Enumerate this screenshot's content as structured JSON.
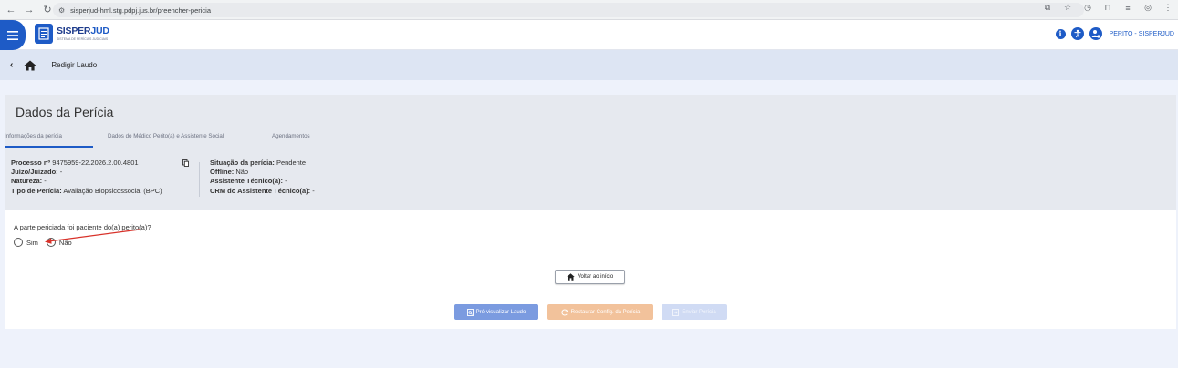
{
  "browser": {
    "url": "sisperjud-hml.stg.pdpj.jus.br/preencher-pericia",
    "back_icon": "arrow-left-icon",
    "forward_icon": "arrow-right-icon",
    "reload_icon": "reload-icon"
  },
  "header": {
    "logo_main": "SISPER",
    "logo_accent": "JUD",
    "logo_sub": "SISTEMA DE PERÍCIAS JUDICIAIS",
    "user_label": "PERITO - SISPERJUD",
    "info_glyph": "i"
  },
  "subheader": {
    "title": "Redigir Laudo"
  },
  "card": {
    "title": "Dados da Perícia",
    "tabs": [
      {
        "label": "Informações da perícia",
        "active": true
      },
      {
        "label": "Dados do Médico Perito(a) e Assistente Social",
        "active": false
      },
      {
        "label": "Agendamentos",
        "active": false
      }
    ],
    "info": {
      "processo_label": "Processo nº",
      "processo_value": "9475959-22.2026.2.00.4801",
      "juizo_label": "Juízo/Juizado:",
      "juizo_value": "-",
      "natureza_label": "Natureza:",
      "natureza_value": "-",
      "tipo_label": "Tipo de Perícia:",
      "tipo_value": "Avaliação Biopsicossocial (BPC)",
      "situacao_label": "Situação da perícia:",
      "situacao_value": "Pendente",
      "offline_label": "Offline:",
      "offline_value": "Não",
      "assistente_label": "Assistente Técnico(a):",
      "assistente_value": "-",
      "crm_label": "CRM do Assistente Técnico(a):",
      "crm_value": "-"
    },
    "question": "A parte periciada foi paciente do(a) perito(a)?",
    "options": [
      "Sim",
      "Não"
    ],
    "voltar_label": "Voltar ao início",
    "preview_label": "Pré-visualizar Laudo",
    "restore_label": "Restaurar Config. da Perícia",
    "send_label": "Enviar Perícia"
  },
  "colors": {
    "primary": "#1e5bc6",
    "preview_btn": "#7b9be0",
    "restore_btn": "#f2c29b",
    "send_btn": "#d0dbf4",
    "annotation_arrow": "#d8322a"
  }
}
